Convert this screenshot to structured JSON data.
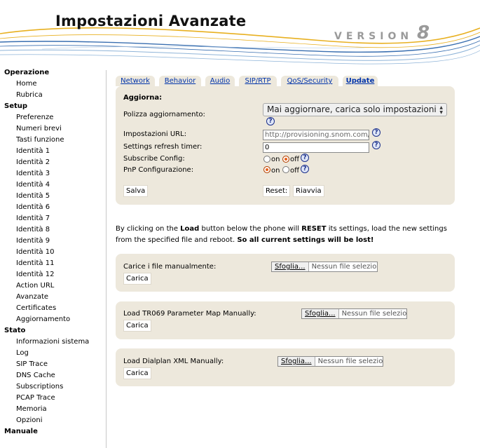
{
  "header": {
    "title": "Impostazioni Avanzate",
    "version_label": "VERSION",
    "version_number": "8",
    "accent_colors": [
      "#e8b020",
      "#3a6fb0",
      "#8fb4d8"
    ]
  },
  "sidebar": {
    "sections": [
      {
        "label": "Operazione",
        "items": [
          "Home",
          "Rubrica"
        ]
      },
      {
        "label": "Setup",
        "items": [
          "Preferenze",
          "Numeri brevi",
          "Tasti funzione",
          "Identità 1",
          "Identità 2",
          "Identità 3",
          "Identità 4",
          "Identità 5",
          "Identità 6",
          "Identità 7",
          "Identità 8",
          "Identità 9",
          "Identità 10",
          "Identità 11",
          "Identità 12",
          "Action URL",
          "Avanzate",
          "Certificates",
          "Aggiornamento"
        ]
      },
      {
        "label": "Stato",
        "items": [
          "Informazioni sistema",
          "Log",
          "SIP Trace",
          "DNS Cache",
          "Subscriptions",
          "PCAP Trace",
          "Memoria",
          "Opzioni"
        ]
      },
      {
        "label": "Manuale",
        "items": []
      }
    ]
  },
  "tabs": [
    {
      "label": "Network",
      "active": false
    },
    {
      "label": "Behavior",
      "active": false
    },
    {
      "label": "Audio",
      "active": false
    },
    {
      "label": "SIP/RTP",
      "active": false
    },
    {
      "label": "QoS/Security",
      "active": false
    },
    {
      "label": "Update",
      "active": true
    }
  ],
  "update_panel": {
    "heading": "Aggiorna:",
    "policy_label": "Polizza aggiornamento:",
    "policy_value": "Mai aggiornare, carica solo impostazioni",
    "url_label": "Impostazioni URL:",
    "url_value": "http://provisioning.snom.com/snom",
    "refresh_label": "Settings refresh timer:",
    "refresh_value": "0",
    "subscribe_label": "Subscribe Config:",
    "subscribe_on_label": "on",
    "subscribe_off_label": "off",
    "subscribe_selected": "off",
    "pnp_label": "PnP Configurazione:",
    "pnp_on_label": "on",
    "pnp_off_label": "off",
    "pnp_selected": "on",
    "save_label": "Salva",
    "reset_label": "Reset:",
    "reboot_label": "Riavvia",
    "help_glyph": "?"
  },
  "warning": {
    "part1": "By clicking on the ",
    "load_word": "Load",
    "part2": " button below the phone will ",
    "reset_word": "RESET",
    "part3": " its settings, load the new settings from the specified file and reboot. ",
    "final": "So all current settings will be lost!"
  },
  "file_panels": [
    {
      "label": "Carice i file manualmente:",
      "browse_label": "Sfoglia...",
      "file_status": "Nessun file selezionato.",
      "load_label": "Carica"
    },
    {
      "label": "Load TR069 Parameter Map Manually:",
      "browse_label": "Sfoglia...",
      "file_status": "Nessun file selezionato.",
      "load_label": "Carica"
    },
    {
      "label": "Load Dialplan XML Manually:",
      "browse_label": "Sfoglia...",
      "file_status": "Nessun file selezionato.",
      "load_label": "Carica"
    }
  ]
}
